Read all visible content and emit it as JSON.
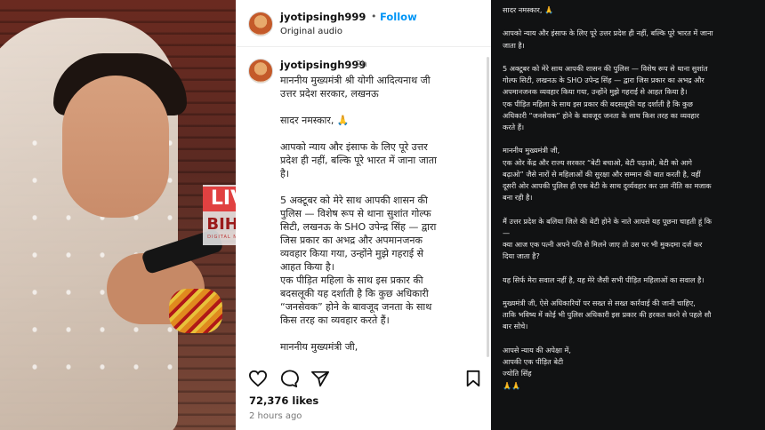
{
  "post": {
    "username": "jyotipsingh999",
    "separator": "•",
    "follow_label": "Follow",
    "audio": "Original audio",
    "time": "2h",
    "caption": "माननीय मुख्यमंत्री श्री योगी आदित्यनाथ जी\nउत्तर प्रदेश सरकार, लखनऊ\n\nसादर नमस्कार, 🙏\n\nआपको न्याय और इंसाफ के लिए पूरे उत्तर\nप्रदेश ही नहीं, बल्कि पूरे भारत में जाना जाता\nहै।\n\n5 अक्टूबर को मेरे साथ आपकी शासन की\nपुलिस — विशेष रूप से थाना सुशांत गोल्फ\nसिटी, लखनऊ के SHO उपेन्द्र सिंह — द्वारा\nजिस प्रकार का अभद्र और अपमानजनक\nव्यवहार किया गया, उन्होंने मुझे गहराई से\nआहत किया है।\nएक पीड़ित महिला के साथ इस प्रकार की\nबदसलूकी यह दर्शाती है कि कुछ अधिकारी\n“जनसेवक” होने के बावजूद जनता के साथ\nकिस तरह का व्यवहार करते हैं।\n\nमाननीय मुख्यमंत्री जी,",
    "likes": "72,376 likes",
    "posted_ago": "2 hours ago",
    "icons": [
      "heart-icon",
      "comment-icon",
      "share-icon",
      "bookmark-icon"
    ]
  },
  "watermark": {
    "line1": "LIVE",
    "line2": "BIHAR",
    "line3": "DIGITAL NETWORK"
  },
  "letter": {
    "text": "सादर नमस्कार, 🙏\n\nआपको न्याय और इंसाफ के लिए पूरे उत्तर प्रदेश ही नहीं, बल्कि पूरे भारत में जाना\nजाता है।\n\n5 अक्टूबर को मेरे साथ आपकी शासन की पुलिस — विशेष रूप से थाना सुशांत\nगोल्फ सिटी, लखनऊ के SHO उपेन्द्र सिंह — द्वारा जिस प्रकार का अभद्र और\nअपमानजनक व्यवहार किया गया, उन्होंने मुझे गहराई से आहत किया है।\nएक पीड़ित महिला के साथ इस प्रकार की बदसलूकी यह दर्शाती है कि कुछ\nअधिकारी “जनसेवक” होने के बावजूद जनता के साथ किस तरह का व्यवहार\nकरते हैं।\n\nमाननीय मुख्यमंत्री जी,\nएक ओर केंद्र और राज्य सरकार “बेटी बचाओ, बेटी पढ़ाओ, बेटी को आगे\nबढ़ाओ” जैसे नारों से महिलाओं की सुरक्षा और सम्मान की बात करती है, वहीं\nदूसरी ओर आपकी पुलिस ही एक बेटी के साथ दुर्व्यवहार कर उस नीति का मजाक\nबना रही है।\n\nमैं उत्तर प्रदेश के बलिया जिले की बेटी होने के नाते आपसे यह पूछना चाहती हूं कि\n—\nक्या आज एक पत्नी अपने पति से मिलने जाए तो उस पर भी मुकदमा दर्ज कर\nदिया जाता है?\n\nयह सिर्फ मेरा सवाल नहीं है, यह मेरे जैसी सभी पीड़ित महिलाओं का सवाल है।\n\nमुख्यमंत्री जी, ऐसे अधिकारियों पर सख्त से सख्त कार्रवाई की जानी चाहिए,\nताकि भविष्य में कोई भी पुलिस अधिकारी इस प्रकार की हरकत करने से पहले सौ\nबार सोचे।\n\nआपसे न्याय की अपेक्षा में,\nआपकी एक पीड़ित बेटी\nज्योति सिंह\n🙏🙏"
  },
  "colors": {
    "follow": "#0095f6",
    "dark_bg": "#111213",
    "watermark_red": "#e22828"
  }
}
